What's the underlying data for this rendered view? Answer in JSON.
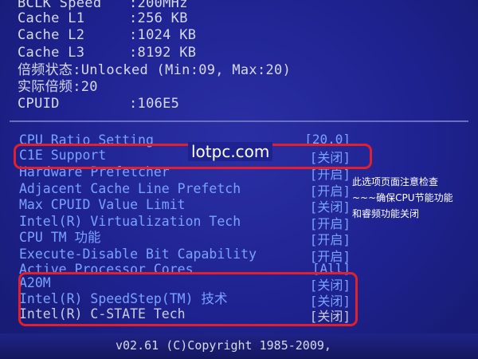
{
  "info": [
    {
      "label": "BCLK Speed",
      "value": ":200MHz"
    },
    {
      "label": "Cache L1",
      "value": ":256 KB"
    },
    {
      "label": "Cache L2",
      "value": ":1024 KB"
    },
    {
      "label": "Cache L3",
      "value": ":8192 KB"
    },
    {
      "label": "倍频状态:Unlocked (Min:09, Max:20)",
      "value": ""
    },
    {
      "label": "实际倍频:20",
      "value": ""
    },
    {
      "label": "CPUID",
      "value": ":106E5"
    }
  ],
  "settings": [
    {
      "label": "CPU Ratio Setting",
      "value": "[20.0]"
    },
    {
      "label": "C1E Support",
      "value": "[关闭]"
    },
    {
      "label": "Hardware Prefetcher",
      "value": "[开启]"
    },
    {
      "label": "Adjacent Cache Line Prefetch",
      "value": "[开启]"
    },
    {
      "label": "Max CPUID Value Limit",
      "value": "[关闭]"
    },
    {
      "label": "Intel(R) Virtualization Tech",
      "value": "[开启]"
    },
    {
      "label": "CPU TM 功能",
      "value": "[开启]"
    },
    {
      "label": "Execute-Disable Bit Capability",
      "value": "[开启]"
    },
    {
      "label": "Active Processor Cores",
      "value": "[All]"
    },
    {
      "label": "A20M",
      "value": "[关闭]"
    },
    {
      "label": "Intel(R) SpeedStep(TM) 技术",
      "value": "[关闭]"
    },
    {
      "label": "Intel(R) C-STATE Tech",
      "value": "[关闭]"
    }
  ],
  "watermark": "lotpc.com",
  "annotation": [
    "此选项页面注意检查",
    "~~~确保CPU节能功能",
    "和睿频功能关闭"
  ],
  "footer": "v02.61 (C)Copyright 1985-2009,",
  "colors": {
    "background": "#1e2290",
    "setting_text": "#7aa2ff",
    "highlight_box": "#e2202d"
  }
}
